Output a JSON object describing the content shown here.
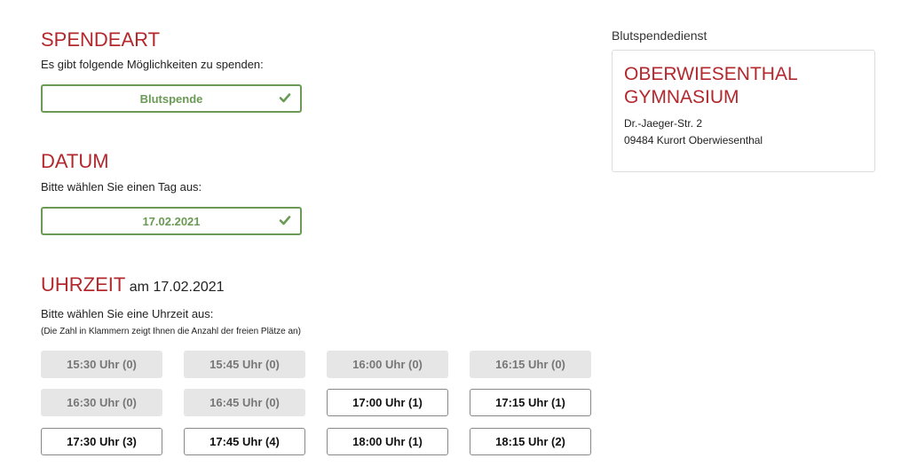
{
  "spendeart": {
    "heading": "SPENDEART",
    "text": "Es gibt folgende Möglichkeiten zu spenden:",
    "selected": "Blutspende"
  },
  "datum": {
    "heading": "DATUM",
    "text": "Bitte wählen Sie einen Tag aus:",
    "selected": "17.02.2021"
  },
  "uhrzeit": {
    "heading": "UHRZEIT",
    "subheading": "am 17.02.2021",
    "text": "Bitte wählen Sie eine Uhrzeit aus:",
    "hint": "(Die Zahl in Klammern zeigt Ihnen die Anzahl der freien Plätze an)",
    "slots": [
      {
        "label": "15:30 Uhr (0)",
        "available": false
      },
      {
        "label": "15:45 Uhr (0)",
        "available": false
      },
      {
        "label": "16:00 Uhr (0)",
        "available": false
      },
      {
        "label": "16:15 Uhr (0)",
        "available": false
      },
      {
        "label": "16:30 Uhr (0)",
        "available": false
      },
      {
        "label": "16:45 Uhr (0)",
        "available": false
      },
      {
        "label": "17:00 Uhr (1)",
        "available": true
      },
      {
        "label": "17:15 Uhr (1)",
        "available": true
      },
      {
        "label": "17:30 Uhr (3)",
        "available": true
      },
      {
        "label": "17:45 Uhr (4)",
        "available": true
      },
      {
        "label": "18:00 Uhr (1)",
        "available": true
      },
      {
        "label": "18:15 Uhr (2)",
        "available": true
      }
    ]
  },
  "sidebar": {
    "label": "Blutspendedienst",
    "location_line1": "OBERWIESENTHAL",
    "location_line2": "GYMNASIUM",
    "street": "Dr.-Jaeger-Str. 2",
    "city": "09484 Kurort Oberwiesenthal"
  },
  "colors": {
    "accent_red": "#b3282d",
    "success_green": "#6a9a55",
    "disabled_bg": "#e6e6e6"
  },
  "icons": {
    "selected_check": "check-icon"
  }
}
